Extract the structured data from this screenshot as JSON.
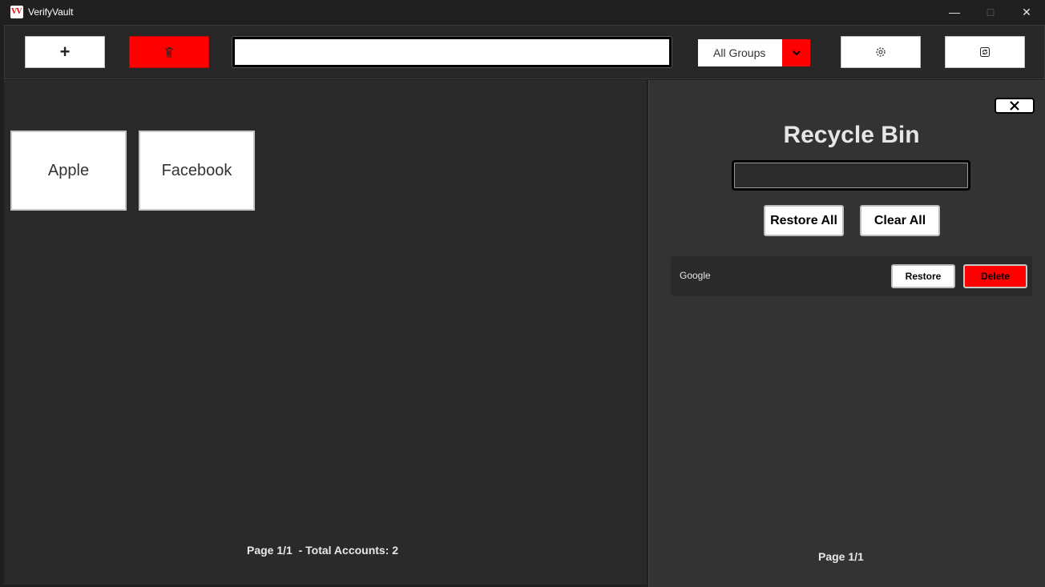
{
  "window": {
    "app_logo_text": "VV",
    "title": "VerifyVault",
    "minimize_glyph": "—",
    "maximize_glyph": "□",
    "close_glyph": "✕"
  },
  "toolbar": {
    "add_glyph": "+",
    "add_icon": "plus-icon",
    "trash_icon": "recycle-bin-icon",
    "search_value": "",
    "group_selected": "All Groups",
    "group_arrow_glyph": "⌄",
    "settings_icon": "gear-icon",
    "refresh_icon": "refresh-icon",
    "accent_color": "#ff0000"
  },
  "main": {
    "accounts": [
      {
        "name": "Apple"
      },
      {
        "name": "Facebook"
      }
    ],
    "footer": "Page 1/1  - Total Accounts: 2"
  },
  "recycle_bin": {
    "close_glyph": "✕",
    "title": "Recycle Bin",
    "search_value": "",
    "restore_all_label": "Restore All",
    "clear_all_label": "Clear All",
    "items": [
      {
        "name": "Google",
        "restore_label": "Restore",
        "delete_label": "Delete"
      }
    ],
    "footer": "Page 1/1"
  }
}
